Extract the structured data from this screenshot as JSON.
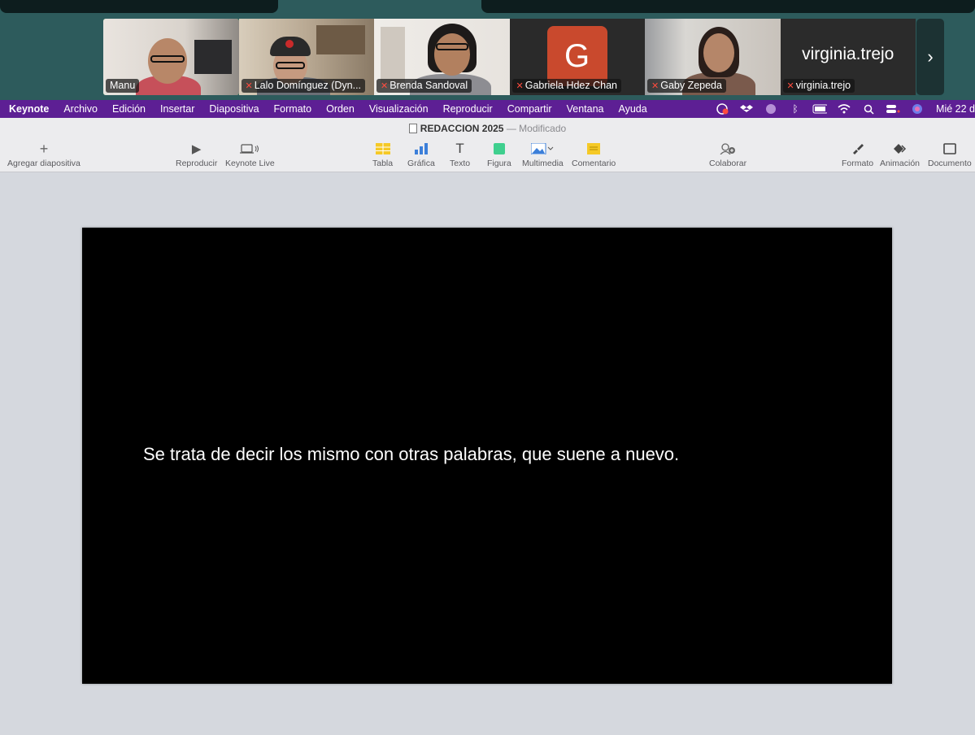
{
  "participants": [
    {
      "name": "Manu",
      "muted": false,
      "active": true
    },
    {
      "name": "Lalo Domínguez (Dyn...",
      "muted": true,
      "active": false
    },
    {
      "name": "Brenda Sandoval",
      "muted": true,
      "active": false
    },
    {
      "name": "Gabriela Hdez Chan",
      "muted": true,
      "active": false,
      "avatar_letter": "G",
      "avatar_color": "#c9492d"
    },
    {
      "name": "Gaby Zepeda",
      "muted": true,
      "active": false
    },
    {
      "name": "virginia.trejo",
      "muted": true,
      "active": false,
      "display_name": "virginia.trejo"
    }
  ],
  "icons": {
    "mute": "mic-off-icon",
    "next": "chevron-right-icon"
  },
  "menubar": {
    "app": "Keynote",
    "items": [
      "Archivo",
      "Edición",
      "Insertar",
      "Diapositiva",
      "Formato",
      "Orden",
      "Visualización",
      "Reproducir",
      "Compartir",
      "Ventana",
      "Ayuda"
    ],
    "clock": "Mié 22 d",
    "color": "#5d1f94"
  },
  "document": {
    "title": "REDACCION 2025",
    "separator": "—",
    "status": "Modificado"
  },
  "toolbar": {
    "add_slide": "Agregar diapositiva",
    "play": "Reproducir",
    "keynote_live": "Keynote Live",
    "table": "Tabla",
    "chart": "Gráfica",
    "text": "Texto",
    "shape": "Figura",
    "media": "Multimedia",
    "comment": "Comentario",
    "collaborate": "Colaborar",
    "format": "Formato",
    "animate": "Animación",
    "document": "Documento"
  },
  "slide": {
    "text": "Se trata de decir los mismo con otras palabras, que suene a nuevo."
  },
  "colors": {
    "strip": "#2d5b5c",
    "active_border": "#4fd14a",
    "mute": "#ff4b3e"
  }
}
